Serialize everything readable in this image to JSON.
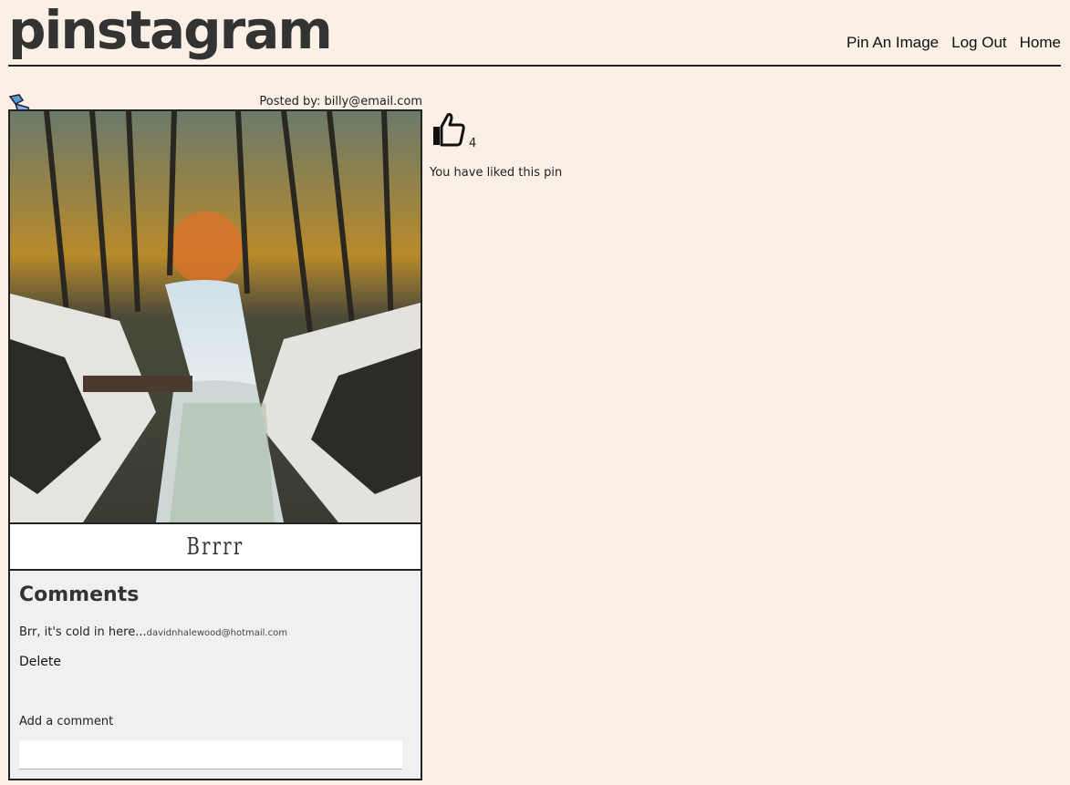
{
  "header": {
    "logo": "pinstagram",
    "nav": [
      "Pin An Image",
      "Log Out",
      "Home"
    ]
  },
  "pin": {
    "posted_by": "Posted by: billy@email.com",
    "caption": "Brrrr",
    "like_count": "4",
    "liked_message": "You have liked this pin"
  },
  "comments": {
    "heading": "Comments",
    "items": [
      {
        "text": "Brr, it's cold in here...",
        "author": "davidnhalewood@hotmail.com"
      }
    ],
    "delete_label": "Delete",
    "add_label": "Add a comment",
    "input_value": ""
  },
  "icons": {
    "pin": "pushpin-icon",
    "like": "thumbs-up-icon"
  }
}
